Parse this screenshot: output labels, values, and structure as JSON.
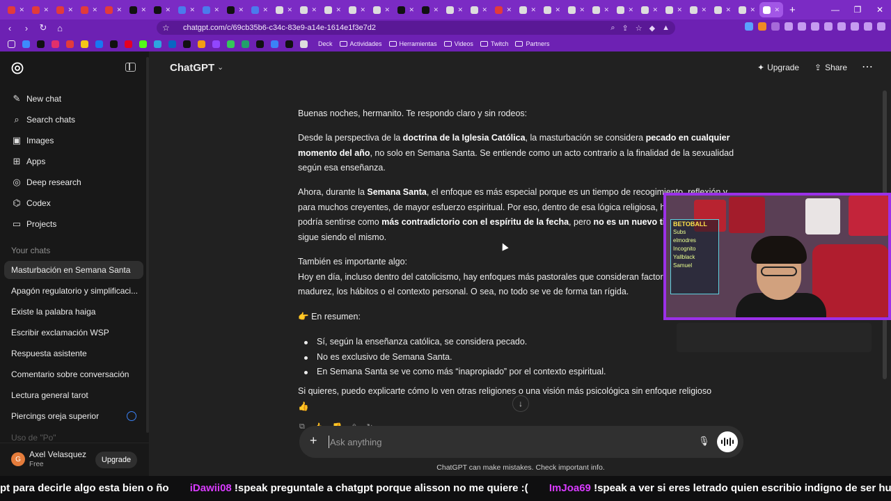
{
  "browser": {
    "url": "chatgpt.com/c/69cb35b6-c34c-83e9-a14e-1614e1f3e7d2",
    "bookmarks": [
      "Deck",
      "Actividades",
      "Herramientas",
      "Videos",
      "Twitch",
      "Partners"
    ]
  },
  "sidebar": {
    "nav": [
      {
        "label": "New chat",
        "icon": "✎"
      },
      {
        "label": "Search chats",
        "icon": "⌕"
      },
      {
        "label": "Images",
        "icon": "▣"
      },
      {
        "label": "Apps",
        "icon": "⊞"
      },
      {
        "label": "Deep research",
        "icon": "◎"
      },
      {
        "label": "Codex",
        "icon": "⌬"
      },
      {
        "label": "Projects",
        "icon": "▭"
      }
    ],
    "section_title": "Your chats",
    "chats": [
      "Masturbación en Semana Santa",
      "Apagón regulatorio y simplificaci...",
      "Existe la palabra haiga",
      "Escribir exclamación WSP",
      "Respuesta asistente",
      "Comentario sobre conversación",
      "Lectura general tarot",
      "Piercings oreja superior"
    ],
    "faded_chat": "Uso de \"Po\"",
    "user": {
      "initial": "G",
      "name": "Axel Velasquez",
      "plan": "Free",
      "upgrade": "Upgrade"
    }
  },
  "header": {
    "model": "ChatGPT",
    "upgrade": "Upgrade",
    "share": "Share"
  },
  "message": {
    "greeting": "Buenas noches, hermanito. Te respondo claro y sin rodeos:",
    "p1_a": "Desde la perspectiva de la ",
    "p1_b": "doctrina de la Iglesia Católica",
    "p1_c": ", la masturbación se considera ",
    "p1_d": "pecado en cualquier momento del año",
    "p1_e": ", no solo en Semana Santa. Se entiende como un acto contrario a la finalidad de la sexualidad según esa enseñanza.",
    "p2_a": "Ahora, durante la ",
    "p2_b": "Semana Santa",
    "p2_c": ", el enfoque es más especial porque es un tiempo de recogimiento, reflexión y, para muchos creyentes, de mayor esfuerzo espiritual. Por eso, dentro de esa lógica religiosa, hacerlo esos días podría sentirse como ",
    "p2_d": "más contradictorio con el espíritu de la fecha",
    "p2_e": ", pero ",
    "p2_f": "no es un nuevo tipo de pecado",
    "p2_g": ": sigue siendo el mismo.",
    "p3_title": "También es importante algo:",
    "p3_body": "Hoy en día, incluso dentro del catolicismo, hay enfoques más pastorales que consideran factores como la edad, la madurez, los hábitos o el contexto personal. O sea, no todo se ve de forma tan rígida.",
    "summary_emoji": "👉",
    "summary_title": "En resumen:",
    "bullets": [
      "Sí, según la enseñanza católica, se considera pecado.",
      "No es exclusivo de Semana Santa.",
      "En Semana Santa se ve como más “inapropiado” por el contexto espiritual."
    ],
    "closing": "Si quieres, puedo explicarte cómo lo ven otras religiones o una visión más psicológica sin enfoque religioso",
    "closing_emoji": "👍"
  },
  "composer": {
    "placeholder": "Ask anything"
  },
  "disclaimer": "ChatGPT can make mistakes. Check important info.",
  "webcam": {
    "panel_title": "BETOBALL",
    "panel_lines": [
      "Subs",
      "elmodres",
      "Incognito",
      "Yallblack",
      "Samuel"
    ]
  },
  "ticker": [
    {
      "user": "",
      "msg": "pt para decirle algo esta bien o ño"
    },
    {
      "user": "iDawii08",
      "msg": " !speak preguntale a chatgpt porque alisson no me quiere :("
    },
    {
      "user": "ImJoa69",
      "msg": " !speak a ver si eres letrado quien escribio indigno de ser humano"
    }
  ],
  "colors": {
    "accent_purple": "#7b2bc4",
    "sidebar_bg": "#181818",
    "main_bg": "#212121",
    "ticker_user": "#d83bff"
  }
}
